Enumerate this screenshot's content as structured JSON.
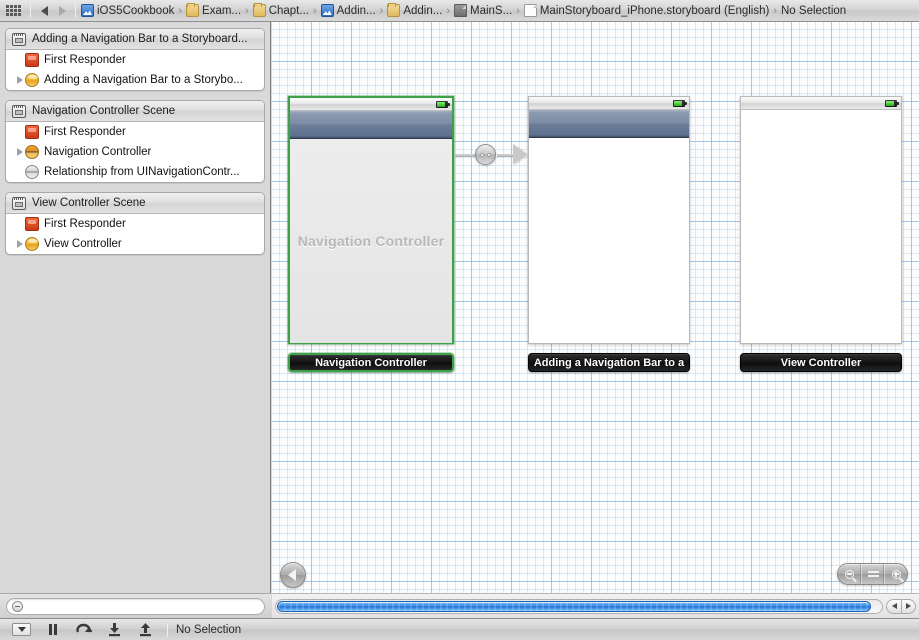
{
  "window": {
    "title": "MainStoryboard_iPhone.storyboard"
  },
  "jumpbar": {
    "grid_icon": "grid-icon",
    "back_icon": "back-arrow-icon",
    "forward_icon": "forward-arrow-icon",
    "crumbs": [
      {
        "label": "iOS5Cookbook",
        "icon": "xcode-project-icon",
        "type": "project"
      },
      {
        "label": "Exam...",
        "icon": "folder-icon",
        "type": "folder"
      },
      {
        "label": "Chapt...",
        "icon": "folder-icon",
        "type": "folder"
      },
      {
        "label": "Addin...",
        "icon": "xcode-project-icon",
        "type": "project"
      },
      {
        "label": "Addin...",
        "icon": "folder-icon",
        "type": "folder"
      },
      {
        "label": "MainS...",
        "icon": "storyboard-icon",
        "type": "storyboard"
      },
      {
        "label": "MainStoryboard_iPhone.storyboard (English)",
        "icon": "document-icon",
        "type": "document"
      },
      {
        "label": "No Selection",
        "icon": "",
        "type": "selection"
      }
    ],
    "separator": "›"
  },
  "outline": {
    "groups": [
      {
        "header": {
          "label": "Adding a Navigation Bar to a Storyboard...",
          "icon": "scene-icon"
        },
        "rows": [
          {
            "label": "First Responder",
            "icon": "first-responder-icon",
            "disclosure": false
          },
          {
            "label": "Adding a Navigation Bar to a Storybo...",
            "icon": "view-controller-icon",
            "disclosure": true
          }
        ]
      },
      {
        "header": {
          "label": "Navigation Controller Scene",
          "icon": "scene-icon"
        },
        "rows": [
          {
            "label": "First Responder",
            "icon": "first-responder-icon",
            "disclosure": false
          },
          {
            "label": "Navigation Controller",
            "icon": "navigation-controller-icon",
            "disclosure": true
          },
          {
            "label": "Relationship from UINavigationContr...",
            "icon": "relationship-icon",
            "disclosure": false
          }
        ]
      },
      {
        "header": {
          "label": "View Controller Scene",
          "icon": "scene-icon"
        },
        "rows": [
          {
            "label": "First Responder",
            "icon": "first-responder-icon",
            "disclosure": false
          },
          {
            "label": "View Controller",
            "icon": "view-controller-icon",
            "disclosure": true
          }
        ]
      }
    ]
  },
  "filter": {
    "placeholder": "",
    "value": "",
    "icon": "filter-icon"
  },
  "canvas": {
    "scenes": [
      {
        "name": "navigation-controller-scene",
        "plaque_label": "Navigation Controller",
        "placeholder_text": "Navigation Controller",
        "selected": true,
        "has_navbar": true,
        "body_style": "grayed"
      },
      {
        "name": "adding-navigation-bar-scene",
        "plaque_label": "Adding a Navigation Bar to a",
        "placeholder_text": "",
        "selected": false,
        "has_navbar": true,
        "body_style": "white"
      },
      {
        "name": "view-controller-scene",
        "plaque_label": "View Controller",
        "placeholder_text": "",
        "selected": false,
        "has_navbar": false,
        "body_style": "white"
      }
    ],
    "connector": {
      "name": "relationship-connector",
      "icon": "relationship-badge-icon"
    },
    "back_button": {
      "icon": "back-triangle-icon"
    },
    "zoom_controls": {
      "zoom_out": "zoom-out-icon",
      "actual_size": "actual-size-icon",
      "zoom_in": "zoom-in-icon"
    }
  },
  "scrollbar": {
    "left_arrow": "scroll-left-icon",
    "right_arrow": "scroll-right-icon"
  },
  "debugbar": {
    "buttons": [
      {
        "name": "breakpoints-button",
        "icon": "breakpoint-dropdown-icon"
      },
      {
        "name": "pause-button",
        "icon": "pause-icon"
      },
      {
        "name": "step-over-button",
        "icon": "step-over-icon"
      },
      {
        "name": "step-into-button",
        "icon": "step-into-icon"
      },
      {
        "name": "step-out-button",
        "icon": "step-out-icon"
      }
    ],
    "status": "No Selection"
  },
  "colors": {
    "selection_green": "#3fa04a",
    "grid_blue": "#78aae1",
    "scroll_blue": "#2f84e4",
    "navbar_blue": "#6d7e99"
  }
}
